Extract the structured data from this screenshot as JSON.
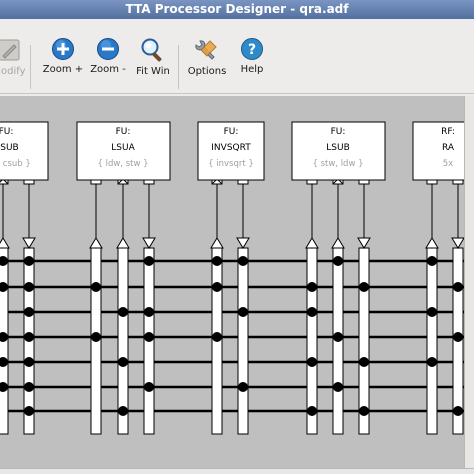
{
  "window": {
    "title": "TTA Processor Designer - qra.adf"
  },
  "toolbar": {
    "modify_label": "Modify",
    "zoom_in_label": "Zoom +",
    "zoom_out_label": "Zoom -",
    "fit_window_label": "Fit Win",
    "options_label": "Options",
    "help_label": "Help"
  },
  "units": [
    {
      "kind": "FU:",
      "name": "DSUB",
      "ops": "{ ..., csub }"
    },
    {
      "kind": "FU:",
      "name": "LSUA",
      "ops": "{ ldw, stw }"
    },
    {
      "kind": "FU:",
      "name": "INVSQRT",
      "ops": "{ invsqrt }"
    },
    {
      "kind": "FU:",
      "name": "LSUB",
      "ops": "{ stw, ldw }"
    },
    {
      "kind": "RF:",
      "name": "RA",
      "ops": "5x"
    }
  ],
  "colors": {
    "canvas_bg": "#bfbfbf",
    "unit_box": "#ffffff",
    "bus_line": "#000000",
    "op_text": "#a0a0a0",
    "titlebar": "#52709f"
  },
  "icons": [
    "modify-icon",
    "zoom-in-icon",
    "zoom-out-icon",
    "fit-window-icon",
    "options-icon",
    "help-icon"
  ]
}
